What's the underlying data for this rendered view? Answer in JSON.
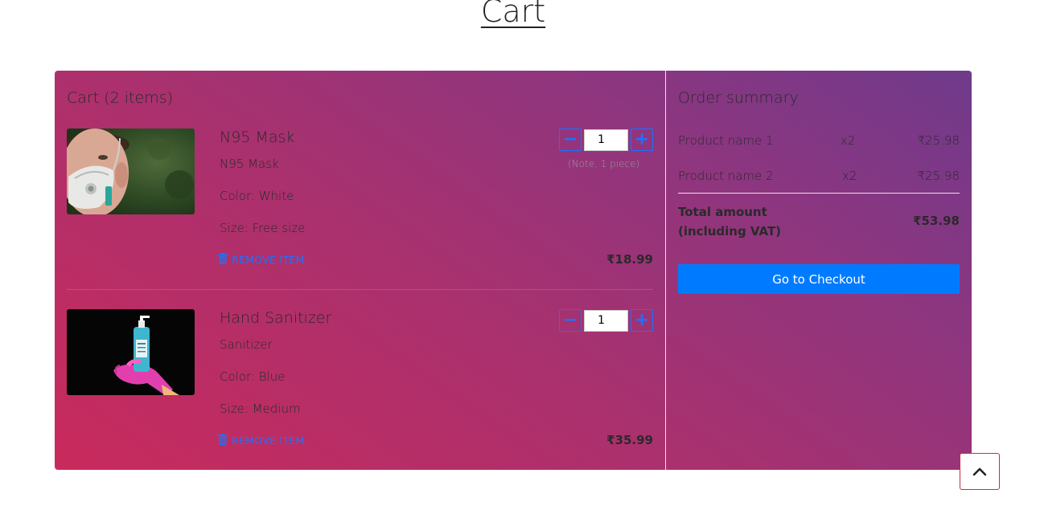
{
  "page": {
    "title": "Cart"
  },
  "cart": {
    "title": "Cart (2 items)",
    "remove_label": "REMOVE ITEM",
    "items": [
      {
        "name": "N95 Mask",
        "subtitle": "N95 Mask",
        "color": "Color: White",
        "size": "Size: Free size",
        "quantity": "1",
        "note": "(Note, 1 piece)",
        "price": "₹18.99"
      },
      {
        "name": "Hand Sanitizer",
        "subtitle": "Sanitizer",
        "color": "Color: Blue",
        "size": "Size: Medium",
        "quantity": "1",
        "price": "₹35.99"
      }
    ]
  },
  "summary": {
    "title": "Order summary",
    "rows": [
      {
        "name": "Product name 1",
        "qty": "x2",
        "price": "₹25.98"
      },
      {
        "name": "Product name 2",
        "qty": "x2",
        "price": "₹25.98"
      }
    ],
    "total_label_line1": "Total amount",
    "total_label_line2": "(including VAT)",
    "total_value": "₹53.98",
    "checkout_label": "Go to Checkout"
  },
  "colors": {
    "accent": "#007bff",
    "link": "#1a73ff",
    "gradient_start": "#c92a5c",
    "gradient_end": "#6f3a8b",
    "scroll_border": "#c92a44"
  },
  "icons": {
    "remove": "trash-icon",
    "qty_minus": "minus-icon",
    "qty_plus": "plus-icon",
    "scroll_top": "chevron-up-icon"
  }
}
